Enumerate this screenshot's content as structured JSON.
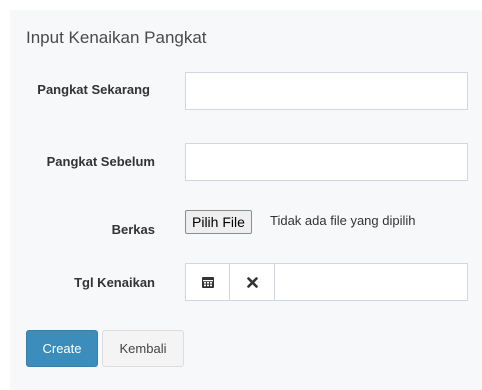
{
  "form": {
    "title": "Input Kenaikan Pangkat",
    "fields": {
      "pangkat_sekarang": {
        "label": "Pangkat Sekarang",
        "value": ""
      },
      "pangkat_sebelum": {
        "label": "Pangkat Sebelum",
        "value": ""
      },
      "berkas": {
        "label": "Berkas",
        "button_label": "Pilih File",
        "status": "Tidak ada file yang dipilih"
      },
      "tgl_kenaikan": {
        "label": "Tgl Kenaikan",
        "value": "",
        "calendar_icon": "calendar-icon",
        "clear_icon": "clear-x-icon"
      }
    },
    "buttons": {
      "create_label": "Create",
      "back_label": "Kembali"
    }
  },
  "colors": {
    "primary": "#3c8dbc",
    "panel_bg": "#f7f8fa",
    "default_btn": "#f4f4f4"
  }
}
